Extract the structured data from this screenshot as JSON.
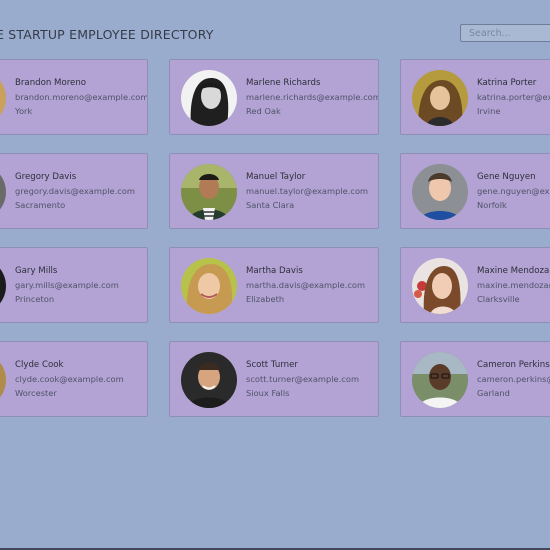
{
  "header": {
    "title": "E STARTUP EMPLOYEE DIRECTORY",
    "search_placeholder": "Search..."
  },
  "colors": {
    "page_bg": "#9aaccd",
    "card_bg": "#b3a2d4",
    "card_border": "#8d8fb7"
  },
  "employees": [
    {
      "name": "Brandon Moreno",
      "email": "brandon.moreno@example.com",
      "city": "York",
      "avatar": "avatar-photo-icon"
    },
    {
      "name": "Marlene Richards",
      "email": "marlene.richards@example.com",
      "city": "Red Oak",
      "avatar": "avatar-photo-icon"
    },
    {
      "name": "Katrina Porter",
      "email": "katrina.porter@example.com",
      "city": "Irvine",
      "avatar": "avatar-photo-icon"
    },
    {
      "name": "Gregory Davis",
      "email": "gregory.davis@example.com",
      "city": "Sacramento",
      "avatar": "avatar-photo-icon"
    },
    {
      "name": "Manuel Taylor",
      "email": "manuel.taylor@example.com",
      "city": "Santa Clara",
      "avatar": "avatar-photo-icon"
    },
    {
      "name": "Gene Nguyen",
      "email": "gene.nguyen@example.com",
      "city": "Norfolk",
      "avatar": "avatar-photo-icon"
    },
    {
      "name": "Gary Mills",
      "email": "gary.mills@example.com",
      "city": "Princeton",
      "avatar": "avatar-photo-icon"
    },
    {
      "name": "Martha Davis",
      "email": "martha.davis@example.com",
      "city": "Elizabeth",
      "avatar": "avatar-photo-icon"
    },
    {
      "name": "Maxine Mendoza",
      "email": "maxine.mendoza@example.com",
      "city": "Clarksville",
      "avatar": "avatar-photo-icon"
    },
    {
      "name": "Clyde Cook",
      "email": "clyde.cook@example.com",
      "city": "Worcester",
      "avatar": "avatar-photo-icon"
    },
    {
      "name": "Scott Turner",
      "email": "scott.turner@example.com",
      "city": "Sioux Falls",
      "avatar": "avatar-photo-icon"
    },
    {
      "name": "Cameron Perkins",
      "email": "cameron.perkins@example.com",
      "city": "Garland",
      "avatar": "avatar-photo-icon"
    }
  ]
}
